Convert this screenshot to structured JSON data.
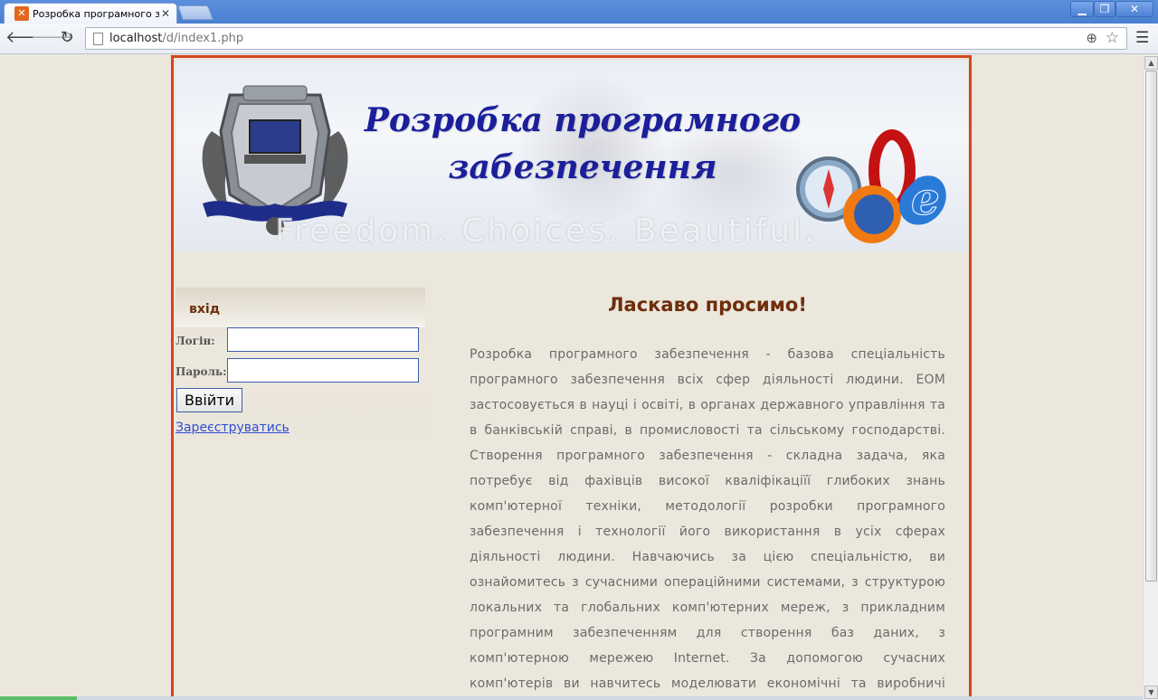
{
  "browser": {
    "tab_title": "Розробка програмного забе",
    "url_host": "localhost",
    "url_path": "/d/index1.php"
  },
  "banner": {
    "title_line1": "Розробка програмного",
    "title_line2": "забезпечення",
    "tagline": "Freedom. Choices. Beautiful."
  },
  "login": {
    "heading": "вхід",
    "login_label": "Логін:",
    "password_label": "Пароль:",
    "login_value": "",
    "password_value": "",
    "submit_label": "Ввійти",
    "register_link": "Зареєструватись"
  },
  "content": {
    "welcome": "Ласкаво просимо!",
    "article": "Розробка програмного забезпечення - базова спеціальність програмного забезпечення всіх сфер діяльності людини. ЕОМ застосовується в науці і освіті, в органах державного управління та в банківській справі, в промисловості та сільському господарстві. Створення програмного забезпечення - складна задача, яка потребує від фахівців високої кваліфікаціїї глибоких знань комп'ютерної техніки, методології розробки програмного забезпечення і технології його використання в усіх сферах діяльності людини. Навчаючись за цією спеціальністю, ви ознайомитесь з сучасними операційними системами, з структурою локальних та глобальних комп'ютерних мереж, з прикладним програмним забезпеченням для створення баз даних, з комп'ютерною мережею Internet. За допомогою сучасних комп'ютерів ви навчитесь моделювати економічні та виробничі процеси, проектувати автоматизовані комп'ютерні системи."
  },
  "colors": {
    "page_border": "#d2451f",
    "heading": "#6e2e0c",
    "link": "#2e4ed4",
    "banner_title": "#1b1f9a"
  }
}
